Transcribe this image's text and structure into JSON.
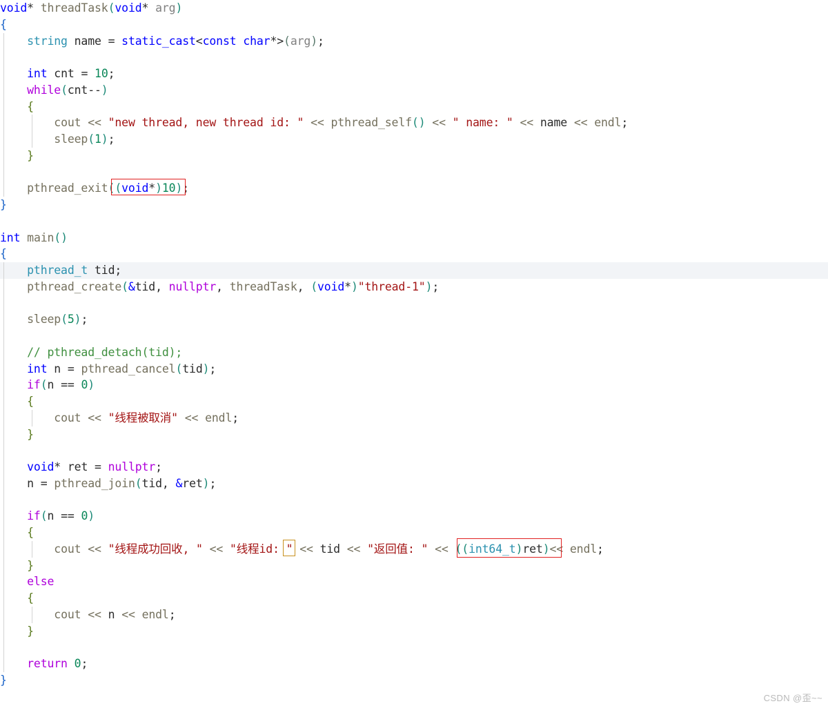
{
  "editor": {
    "language": "cpp",
    "background_color": "#ffffff",
    "current_line_highlight": "#f2f4f7",
    "font_size_px": 16.5,
    "line_height_px": 23.75
  },
  "colors": {
    "keyword": "#0000ff",
    "control_keyword": "#af00db",
    "type": "#2b91af",
    "function": "#74705d",
    "string": "#a31515",
    "number": "#098658",
    "comment": "#3f8f3f",
    "paren": "#1d8a78",
    "brace": "#5a7a1e",
    "outer_brace": "#1a63c8",
    "default_text": "#2b2b2b",
    "annotation_red": "#e02020",
    "annotation_orange": "#c8901e",
    "watermark": "#b9b9b9"
  },
  "code": {
    "lines": [
      "void* threadTask(void* arg)",
      "{",
      "    string name = static_cast<const char*>(arg);",
      "",
      "    int cnt = 10;",
      "    while(cnt--)",
      "    {",
      "        cout << \"new thread, new thread id: \" << pthread_self() << \" name: \" << name << endl;",
      "        sleep(1);",
      "    }",
      "",
      "    pthread_exit((void*)10);",
      "}",
      "",
      "int main()",
      "{",
      "    pthread_t tid;",
      "    pthread_create(&tid, nullptr, threadTask, (void*)\"thread-1\");",
      "",
      "    sleep(5);",
      "",
      "    // pthread_detach(tid);",
      "    int n = pthread_cancel(tid);",
      "    if(n == 0)",
      "    {",
      "        cout << \"线程被取消\" << endl;",
      "    }",
      "",
      "    void* ret = nullptr;",
      "    n = pthread_join(tid, &ret);",
      "",
      "    if(n == 0)",
      "    {",
      "        cout << \"线程成功回收, \" << \"线程id: \" << tid << \"返回值: \" << ((int64_t)ret) << endl;",
      "    }",
      "    else",
      "    {",
      "        cout << n << endl;",
      "    }",
      "",
      "    return 0;",
      "}"
    ],
    "current_line_index": 16,
    "current_line_text": "    pthread_t tid;"
  },
  "annotations": [
    {
      "name": "pthread-exit-argument-highlight",
      "color": "#e02020",
      "shape": "rectangle",
      "target_text": "((void*)10)"
    },
    {
      "name": "thread-id-colon-highlight",
      "color": "#c8901e",
      "shape": "rectangle",
      "target_text": ": "
    },
    {
      "name": "int64-cast-highlight",
      "color": "#e02020",
      "shape": "rectangle",
      "target_text": "((int64_t)ret)"
    }
  ],
  "watermark": {
    "text": "CSDN @歪~~"
  }
}
